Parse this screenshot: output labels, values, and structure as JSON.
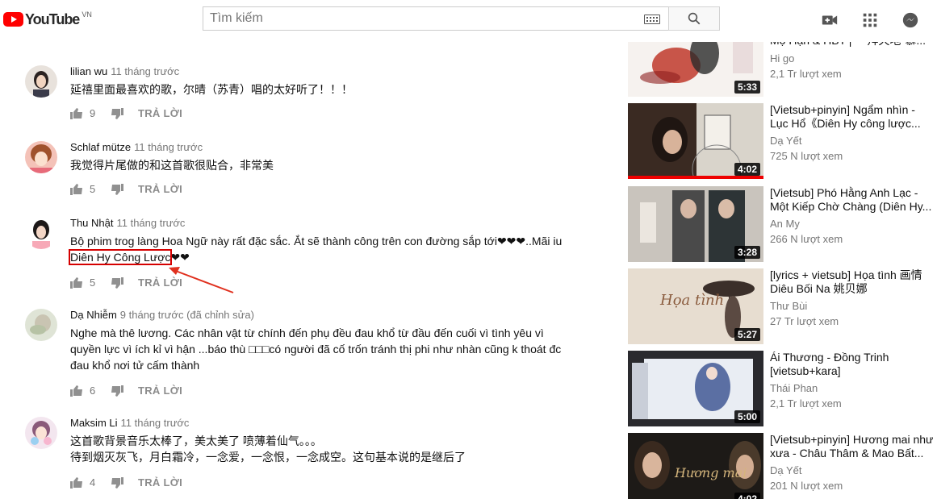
{
  "header": {
    "logo_text": "YouTube",
    "country": "VN",
    "search_placeholder": "Tìm kiếm"
  },
  "comments": [
    {
      "author": "lilian wu",
      "time": "11 tháng trước",
      "text": "延禧里面最喜欢的歌，尔晴（苏青）唱的太好听了！！！",
      "likes": "9",
      "reply": "TRẢ LỜI"
    },
    {
      "author": "Schlaf mütze",
      "time": "11 tháng trước",
      "text": "我觉得片尾做的和这首歌很贴合，非常美",
      "likes": "5",
      "reply": "TRẢ LỜI"
    },
    {
      "author": "Thu Nhật",
      "time": "11 tháng trước",
      "text_part1": "Bộ phim trog làng  Hoa Ngữ này rất đặc sắc. Ắt sẽ thành công trên con đường sắp tới❤❤❤..Mãi iu",
      "text_highlight": "Diên Hy Công Lược",
      "text_part2": "❤❤",
      "likes": "5",
      "reply": "TRẢ LỜI"
    },
    {
      "author": "Dạ Nhiễm",
      "time": "9 tháng trước (đã chỉnh sửa)",
      "text": "Nghe mà thê lương. Các nhân vật từ chính đến phụ đều đau khổ từ đầu đến cuối vì tình yêu vì quyền lực vì ích kỉ vì hận ...báo thù □□□có người đã cố trốn tránh thị phi như nhàn cũng k thoát đc đau khổ nơi tử cấm thành",
      "likes": "6",
      "reply": "TRẢ LỜI"
    },
    {
      "author": "Maksim Li",
      "time": "11 tháng trước",
      "text_line1": "这首歌背景音乐太棒了，美太美了 喷薄着仙气。。。",
      "text_line2": "待到烟灭灰飞，月白霜冷，一念爱，一念恨，一念成空。这句基本说的是继后了",
      "likes": "4",
      "reply": "TRẢ LỜI"
    }
  ],
  "related": [
    {
      "title": "Mộ Hạn & HBT |\"一拜天地\"慕...",
      "channel": "Hi go",
      "views": "2,1 Tr lượt xem",
      "duration": "5:33"
    },
    {
      "title": "[Vietsub+pinyin] Ngẩm nhìn - Lục Hổ《Diên Hy công lược...",
      "channel": "Dạ Yết",
      "views": "725 N lượt xem",
      "duration": "4:02",
      "progress": 1.0
    },
    {
      "title": "[Vietsub] Phó Hằng Anh Lạc - Một Kiếp Chờ Chàng (Diên Hy...",
      "channel": "An My",
      "views": "266 N lượt xem",
      "duration": "3:28"
    },
    {
      "title": "[lyrics + vietsub] Họa tình 画情 Diêu Bối Na 姚贝娜",
      "channel": "Thư Bùi",
      "views": "27 Tr lượt xem",
      "duration": "5:27"
    },
    {
      "title": "Ái Thương - Đồng Trinh [vietsub+kara]",
      "channel": "Thái Phan",
      "views": "2,1 Tr lượt xem",
      "duration": "5:00"
    },
    {
      "title": "[Vietsub+pinyin] Hương mai như xưa - Châu Thâm & Mao Bất...",
      "channel": "Dạ Yết",
      "views": "201 N lượt xem",
      "duration": "4:02"
    }
  ],
  "colors": {
    "brand_red": "#ff0000",
    "annotation_red": "#d50000"
  }
}
